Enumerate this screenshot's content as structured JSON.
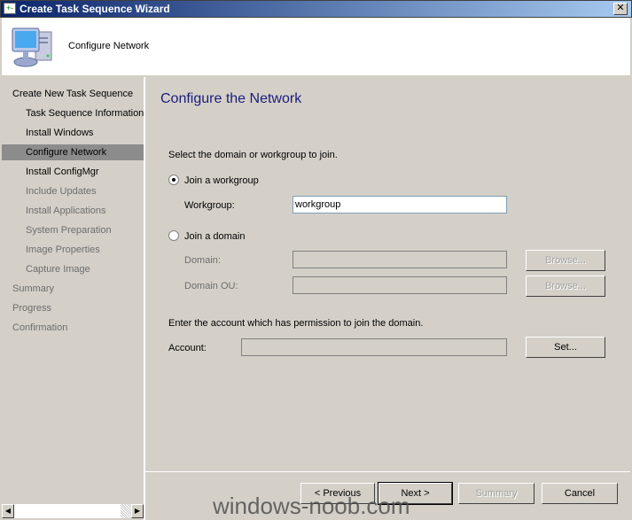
{
  "window": {
    "title": "Create Task Sequence Wizard",
    "close": "✕"
  },
  "header": {
    "text": "Configure Network",
    "icon": "computer-icon"
  },
  "sidebar": {
    "items": [
      {
        "label": "Create New Task Sequence",
        "level": "top",
        "state": "normal"
      },
      {
        "label": "Task Sequence Information",
        "level": "sub",
        "state": "normal"
      },
      {
        "label": "Install Windows",
        "level": "sub",
        "state": "normal"
      },
      {
        "label": "Configure Network",
        "level": "sub",
        "state": "selected"
      },
      {
        "label": "Install ConfigMgr",
        "level": "sub",
        "state": "normal"
      },
      {
        "label": "Include Updates",
        "level": "sub",
        "state": "dim"
      },
      {
        "label": "Install Applications",
        "level": "sub",
        "state": "dim"
      },
      {
        "label": "System Preparation",
        "level": "sub",
        "state": "dim"
      },
      {
        "label": "Image Properties",
        "level": "sub",
        "state": "dim"
      },
      {
        "label": "Capture Image",
        "level": "sub",
        "state": "dim"
      },
      {
        "label": "Summary",
        "level": "top",
        "state": "dim"
      },
      {
        "label": "Progress",
        "level": "top",
        "state": "dim"
      },
      {
        "label": "Confirmation",
        "level": "top",
        "state": "dim"
      }
    ]
  },
  "main": {
    "title": "Configure the Network",
    "instruction": "Select the domain or workgroup to join.",
    "workgroup_radio": "Join a workgroup",
    "workgroup_label": "Workgroup:",
    "workgroup_value": "workgroup",
    "domain_radio": "Join a domain",
    "domain_label": "Domain:",
    "domain_value": "",
    "domain_ou_label": "Domain OU:",
    "domain_ou_value": "",
    "browse": "Browse...",
    "account_instruction": "Enter the account which has permission to join the domain.",
    "account_label": "Account:",
    "account_value": "",
    "set": "Set..."
  },
  "footer": {
    "previous": "< Previous",
    "next": "Next >",
    "summary": "Summary",
    "cancel": "Cancel"
  },
  "watermark": "windows-noob.com"
}
